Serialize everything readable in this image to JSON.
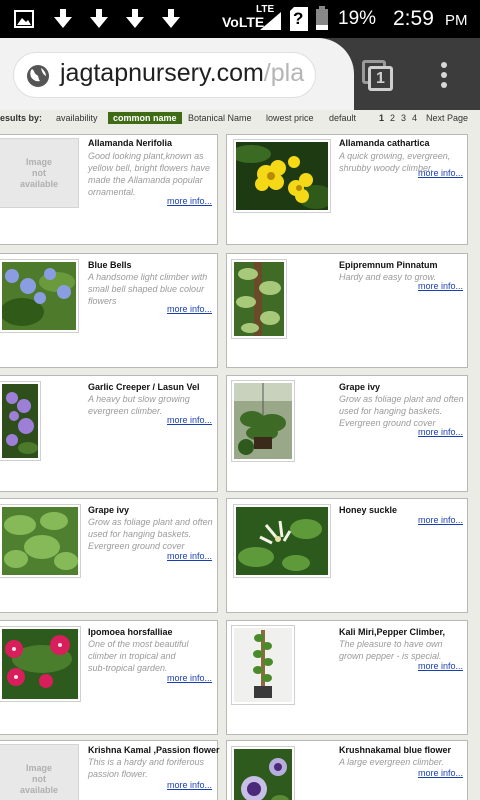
{
  "status_bar": {
    "network": "VoLTE",
    "lte": "LTE",
    "sim": "?",
    "battery": "19%",
    "time": "2:59",
    "ampm": "PM"
  },
  "browser": {
    "url_host": "jagtapnursery.com",
    "url_rest": "/pla",
    "tab_count": "1"
  },
  "sort_bar": {
    "label": "esults by:",
    "options": [
      "availability",
      "common name",
      "Botanical Name",
      "lowest price",
      "default"
    ],
    "pages": [
      "1",
      "2",
      "3",
      "4"
    ],
    "next_label": "Next Page"
  },
  "image_na": [
    "Image",
    "not",
    "available"
  ],
  "more_label": "more info...",
  "products": [
    {
      "name": "Allamanda Nerifolia",
      "desc": [
        "Good looking plant,known as",
        "yellow bell, bright flowers have",
        "made the Allamanda popular",
        "ornamental."
      ]
    },
    {
      "name": "Allamanda cathartica",
      "desc": [
        "A quick growing, evergreen,",
        "shrubby woody climber."
      ]
    },
    {
      "name": "Blue Bells",
      "desc": [
        "A handsome light climber with",
        "small bell shaped blue colour",
        "flowers"
      ]
    },
    {
      "name": "Epipremnum Pinnatum",
      "desc": [
        "Hardy and easy to grow."
      ]
    },
    {
      "name": "Garlic Creeper / Lasun Vel",
      "desc": [
        "A heavy but slow growing",
        "evergreen climber."
      ]
    },
    {
      "name": "Grape ivy",
      "desc": [
        "Grow as foliage plant and often",
        "used for hanging baskets.",
        "Evergreen ground cover"
      ]
    },
    {
      "name": "Grape ivy",
      "desc": [
        "Grow as foliage plant and often",
        "used for hanging baskets.",
        "Evergreen ground cover"
      ]
    },
    {
      "name": "Honey suckle",
      "desc": []
    },
    {
      "name": "Ipomoea horsfalliae",
      "desc": [
        "One of the most beautiful",
        "climber in tropical and",
        "sub-tropical garden."
      ]
    },
    {
      "name": "Kali Miri,Pepper Climber,",
      "desc": [
        "The pleasure to have own",
        "grown pepper - is special."
      ]
    },
    {
      "name": "Krishna Kamal ,Passion flower",
      "desc": [
        "This is a hardy and foriferous",
        "passion flower."
      ]
    },
    {
      "name": "Krushnakamal blue flower",
      "desc": [
        "A large evergreen climber."
      ]
    }
  ]
}
